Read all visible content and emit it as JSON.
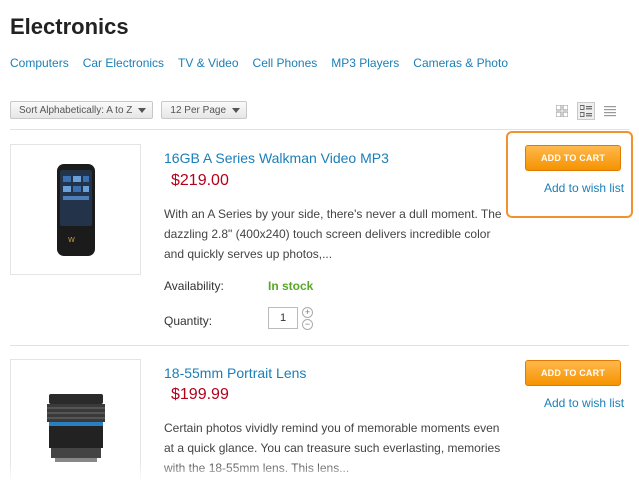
{
  "page": {
    "title": "Electronics"
  },
  "subcategories": [
    "Computers",
    "Car Electronics",
    "TV & Video",
    "Cell Phones",
    "MP3 Players",
    "Cameras & Photo"
  ],
  "toolbar": {
    "sort_value": "Sort Alphabetically: A to Z",
    "per_page_value": "12 Per Page",
    "view_modes": [
      "grid-view-icon",
      "list-view-icon",
      "compact-list-icon"
    ],
    "active_view": "list-view-icon"
  },
  "labels": {
    "availability": "Availability:",
    "quantity": "Quantity:",
    "add_to_cart": "ADD TO CART",
    "add_to_wish": "Add to wish list",
    "plus": "+",
    "minus": "−"
  },
  "products": [
    {
      "name": "16GB A Series Walkman Video MP3",
      "price": "$219.00",
      "description": "With an A Series by your side, there's never a dull moment. The dazzling 2.8\" (400x240) touch screen delivers incredible color and quickly serves up photos,...",
      "availability": "In stock",
      "quantity": "1",
      "image_icon": "mp3-player-icon"
    },
    {
      "name": "18-55mm Portrait Lens",
      "price": "$199.99",
      "description": "Certain photos vividly remind you of memorable moments even at a quick glance. You can treasure such everlasting, memories with the 18-55mm lens. This lens...",
      "image_icon": "camera-lens-icon"
    }
  ],
  "colors": {
    "link": "#1a7fb8",
    "price": "#b3001b",
    "stock": "#58a827",
    "cart_button": "#f59300",
    "highlight": "#f0922e"
  }
}
